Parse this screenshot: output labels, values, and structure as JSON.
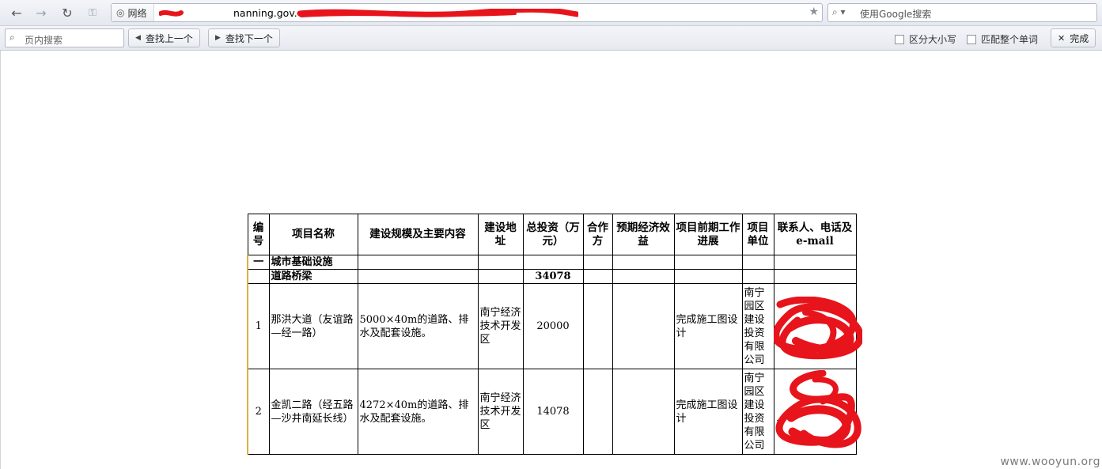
{
  "navbar": {
    "site_badge": "网络",
    "url_visible": "nanning.gov.cn",
    "search_placeholder": "使用Google搜索"
  },
  "findbar": {
    "input_placeholder": "页内搜索",
    "prev_label": "查找上一个",
    "next_label": "查找下一个",
    "match_case_label": "区分大小写",
    "whole_word_label": "匹配整个单词",
    "done_label": "完成"
  },
  "table": {
    "headers": [
      "编号",
      "项目名称",
      "建设规模及主要内容",
      "建设地址",
      "总投资（万元）",
      "合作方",
      "预期经济效益",
      "项目前期工作进展",
      "项目单位",
      "联系人、电话及e-mail"
    ],
    "section": {
      "num": "一",
      "title": "城市基础设施"
    },
    "subsection": {
      "title": "道路桥梁",
      "total": "34078"
    },
    "rows": [
      {
        "num": "1",
        "name": "那洪大道（友谊路—经一路）",
        "scope": "5000×40m的道路、排水及配套设施。",
        "address": "南宁经济技术开发区",
        "investment": "20000",
        "partner": "",
        "benefit": "",
        "progress": "完成施工图设计",
        "unit": "南宁园区建设投资有限公司",
        "contact_visible": "1"
      },
      {
        "num": "2",
        "name": "金凯二路（经五路—沙井南延长线）",
        "scope": "4272×40m的道路、排水及配套设施。",
        "address": "南宁经济技术开发区",
        "investment": "14078",
        "partner": "",
        "benefit": "",
        "progress": "完成施工图设计",
        "unit": "南宁园区建设投资有限公司",
        "contact_visible": "1"
      }
    ]
  },
  "watermark": "www.wooyun.org",
  "colors": {
    "redaction": "#e8141c",
    "toolbar_top": "#f3f5f9",
    "toolbar_bottom": "#e4e8ef"
  }
}
